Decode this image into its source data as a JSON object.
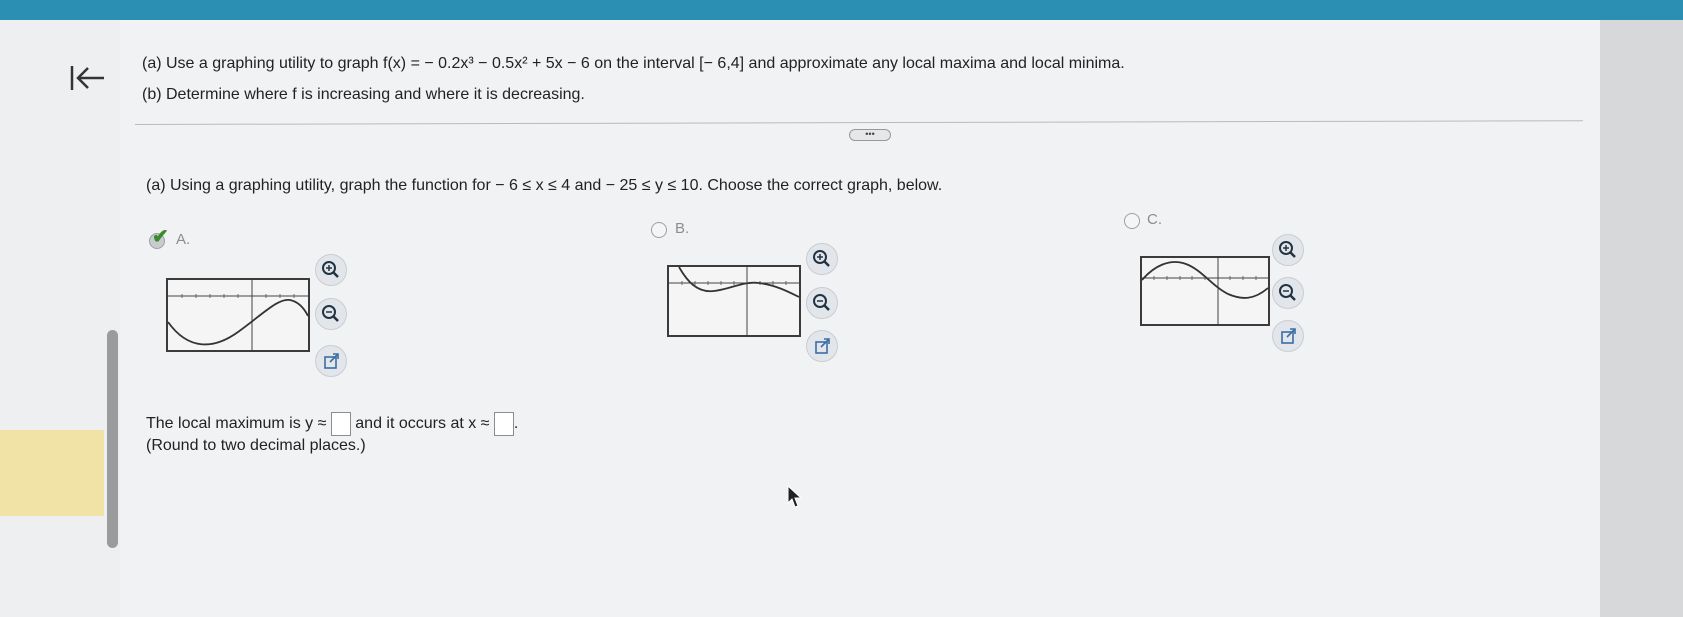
{
  "problem": {
    "part_a": "(a) Use a graphing utility to graph f(x) = − 0.2x³ − 0.5x² + 5x − 6 on the interval [− 6,4] and approximate any local maxima and local minima.",
    "part_b": "(b) Determine where f is increasing and where it is decreasing."
  },
  "more_button": "•••",
  "question": {
    "instruction": "(a) Using a graphing utility, graph the function for  − 6 ≤ x ≤ 4 and  − 25 ≤ y ≤ 10.  Choose the correct graph, below."
  },
  "options": [
    {
      "label": "A.",
      "selected": true,
      "zoom_in": "zoom-in",
      "zoom_out": "zoom-out",
      "open": "open-new-window"
    },
    {
      "label": "B.",
      "selected": false,
      "zoom_in": "zoom-in",
      "zoom_out": "zoom-out",
      "open": "open-new-window"
    },
    {
      "label": "C.",
      "selected": false,
      "zoom_in": "zoom-in",
      "zoom_out": "zoom-out",
      "open": "open-new-window"
    }
  ],
  "answer": {
    "prefix": "The local maximum is y ≈",
    "middle": "and it occurs at x ≈",
    "suffix": ".",
    "y_value": "",
    "x_value": "",
    "hint": "(Round to two decimal places.)"
  },
  "colors": {
    "topbar": "#2a8fb3",
    "check": "#3c8a2e",
    "highlight": "#f1e3a5"
  }
}
